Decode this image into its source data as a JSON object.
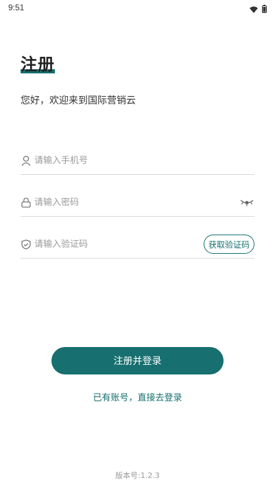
{
  "status_bar": {
    "time": "9:51",
    "icons": [
      "wifi-icon",
      "battery-icon"
    ]
  },
  "page": {
    "title": "注册",
    "welcome": "您好，欢迎来到国际营销云"
  },
  "form": {
    "phone_placeholder": "请输入手机号",
    "password_placeholder": "请输入密码",
    "code_placeholder": "请输入验证码",
    "get_code_label": "获取验证码"
  },
  "actions": {
    "register_label": "注册并登录",
    "login_link": "已有账号，直接去登录"
  },
  "footer": {
    "version": "版本号:1.2.3"
  },
  "colors": {
    "accent": "#176f6f",
    "placeholder": "#9a9a9a",
    "divider": "#d9d9d9"
  }
}
